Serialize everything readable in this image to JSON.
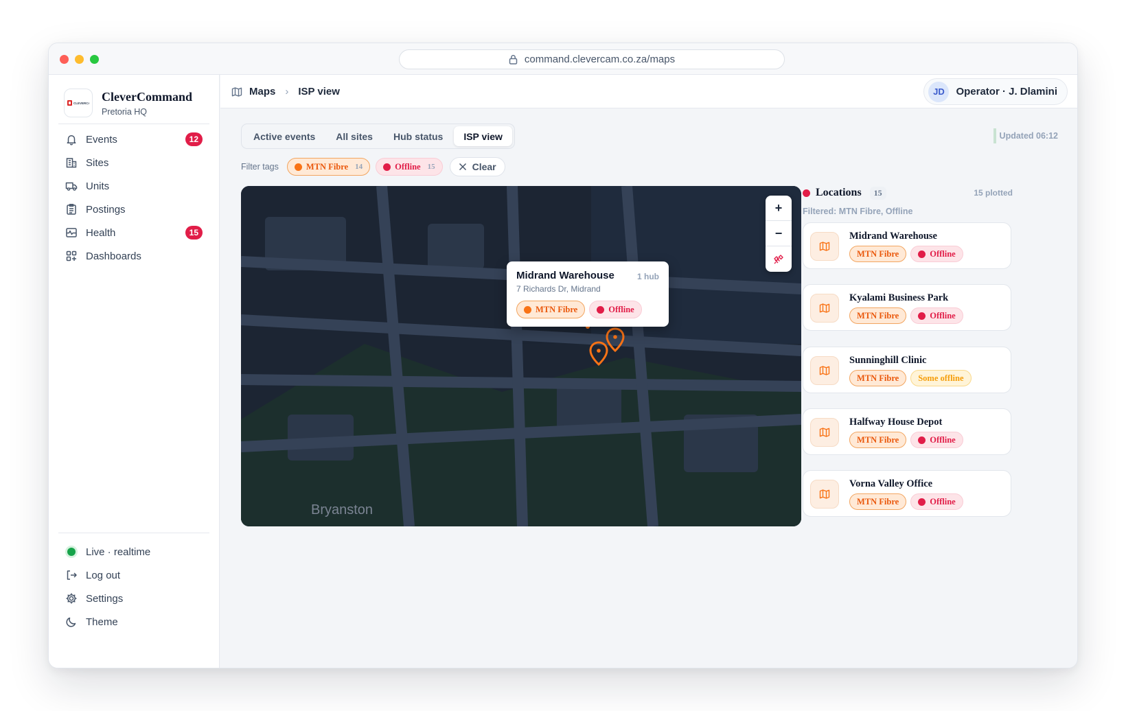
{
  "browser": {
    "url": "command.clevercam.co.za/maps"
  },
  "brand": {
    "name": "CleverCommand",
    "subtitle": "Pretoria HQ",
    "logo_text": "CLEVERCAM"
  },
  "nav": [
    {
      "label": "Events",
      "icon": "bell-icon",
      "badge": "12"
    },
    {
      "label": "Sites",
      "icon": "building-icon"
    },
    {
      "label": "Units",
      "icon": "truck-icon"
    },
    {
      "label": "Postings",
      "icon": "clipboard-icon"
    },
    {
      "label": "Health",
      "icon": "pulse-icon",
      "badge": "15"
    },
    {
      "label": "Dashboards",
      "icon": "grid-icon"
    }
  ],
  "footer": {
    "status": "Live · realtime",
    "logout": "Log out",
    "settings": "Settings",
    "theme": "Theme"
  },
  "breadcrumb": {
    "root": "Maps",
    "current": "ISP view"
  },
  "operator": {
    "initials": "JD",
    "label": "Operator · J. Dlamini"
  },
  "tabs": [
    "Active events",
    "All sites",
    "Hub status",
    "ISP view"
  ],
  "active_tab": "ISP view",
  "updated": "Updated 06:12",
  "filters": {
    "label": "Filter tags",
    "tags": [
      {
        "label": "MTN Fibre",
        "count": "14",
        "color": "#f97316"
      },
      {
        "label": "Offline",
        "count": "15",
        "color": "#e11d48"
      }
    ],
    "clear": "Clear"
  },
  "map": {
    "area_label": "Bryanston",
    "zoom_in": "+",
    "zoom_out": "−",
    "popup": {
      "title": "Midrand Warehouse",
      "hub": "1 hub",
      "address": "7 Richards Dr, Midrand",
      "tags": [
        "MTN Fibre",
        "Offline"
      ]
    }
  },
  "locations": {
    "title": "Locations",
    "count": "15",
    "plotted": "15 plotted",
    "filtered": "Filtered: MTN Fibre, Offline",
    "items": [
      {
        "name": "Midrand Warehouse",
        "isp": "MTN Fibre",
        "status": "Offline"
      },
      {
        "name": "Kyalami Business Park",
        "isp": "MTN Fibre",
        "status": "Offline"
      },
      {
        "name": "Sunninghill Clinic",
        "isp": "MTN Fibre",
        "status": "Some offline"
      },
      {
        "name": "Halfway House Depot",
        "isp": "MTN Fibre",
        "status": "Offline"
      },
      {
        "name": "Vorna Valley Office",
        "isp": "MTN Fibre",
        "status": "Offline"
      }
    ]
  },
  "colors": {
    "isp": "#f97316",
    "offline": "#e11d48",
    "partial": "#f59e0b",
    "live": "#16a34a"
  }
}
